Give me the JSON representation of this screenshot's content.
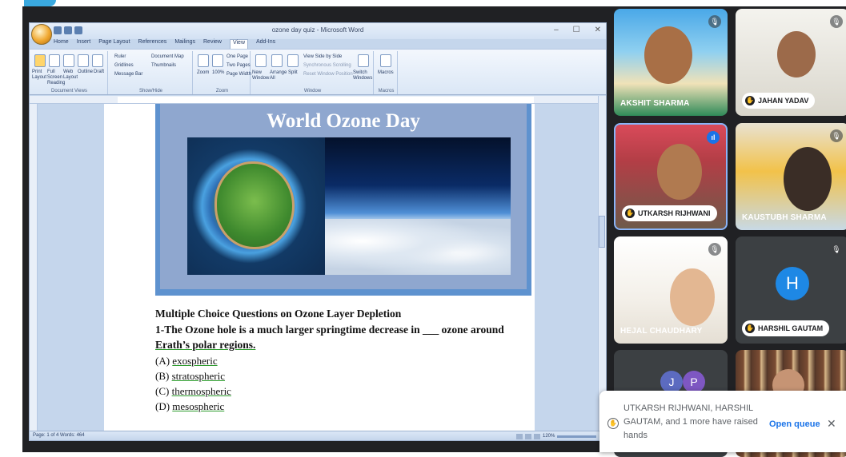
{
  "word": {
    "title": "ozone day quiz - Microsoft Word",
    "window_controls": [
      "–",
      "☐",
      "✕"
    ],
    "tabs": [
      "Home",
      "Insert",
      "Page Layout",
      "References",
      "Mailings",
      "Review",
      "View",
      "Add-Ins"
    ],
    "active_tab": "View",
    "ribbon": {
      "document_views": {
        "label": "Document Views",
        "items": [
          "Print Layout",
          "Full Screen Reading",
          "Web Layout",
          "Outline",
          "Draft"
        ]
      },
      "show_hide": {
        "label": "Show/Hide",
        "items": [
          "Ruler",
          "Gridlines",
          "Message Bar",
          "Document Map",
          "Thumbnails"
        ]
      },
      "zoom": {
        "label": "Zoom",
        "items": [
          "Zoom",
          "100%",
          "One Page",
          "Two Pages",
          "Page Width"
        ]
      },
      "window": {
        "label": "Window",
        "items": [
          "New Window",
          "Arrange All",
          "Split",
          "View Side by Side",
          "Synchronous Scrolling",
          "Reset Window Position",
          "Switch Windows"
        ]
      },
      "macros": {
        "label": "Macros",
        "items": [
          "Macros"
        ]
      }
    },
    "status": "Page: 1 of 4   Words: 464",
    "zoom_level": "120%"
  },
  "document": {
    "banner_title": "World Ozone Day",
    "heading": "Multiple Choice Questions on Ozone Layer Depletion",
    "question_line1": "1-The Ozone hole is a much larger springtime decrease in ___ ozone around",
    "question_line2": "Erath’s polar regions.",
    "options": [
      {
        "prefix": "(A) ",
        "text": "exospheric"
      },
      {
        "prefix": "(B) ",
        "text": "stratospheric"
      },
      {
        "prefix": "(C) ",
        "text": "thermospheric"
      },
      {
        "prefix": "(D) ",
        "text": "mesospheric"
      }
    ]
  },
  "participants": [
    {
      "name": "AKSHIT SHARMA",
      "muted": true
    },
    {
      "name": "JAHAN YADAV",
      "muted": true,
      "hand_raised": true
    },
    {
      "name": "UTKARSH RIJHWANI",
      "speaking": true,
      "hand_raised": true
    },
    {
      "name": "KAUSTUBH SHARMA",
      "muted": true
    },
    {
      "name": "HEJAL CHAUDHARY",
      "muted": true
    },
    {
      "name": "HARSHIL GAUTAM",
      "muted": true,
      "hand_raised": true,
      "avatar_letter": "H"
    },
    {
      "name": "",
      "avatar_letters": [
        "J",
        "P"
      ]
    },
    {
      "name": ""
    }
  ],
  "toast": {
    "message": "UTKARSH RIJHWANI, HARSHIL GAUTAM, and 1 more have raised hands",
    "button": "Open queue",
    "close": "✕"
  },
  "colors": {
    "meet_bg": "#202124",
    "accent": "#1a73e8",
    "avatar": "#1e88e5",
    "word_chrome": "#c5d6ec"
  }
}
